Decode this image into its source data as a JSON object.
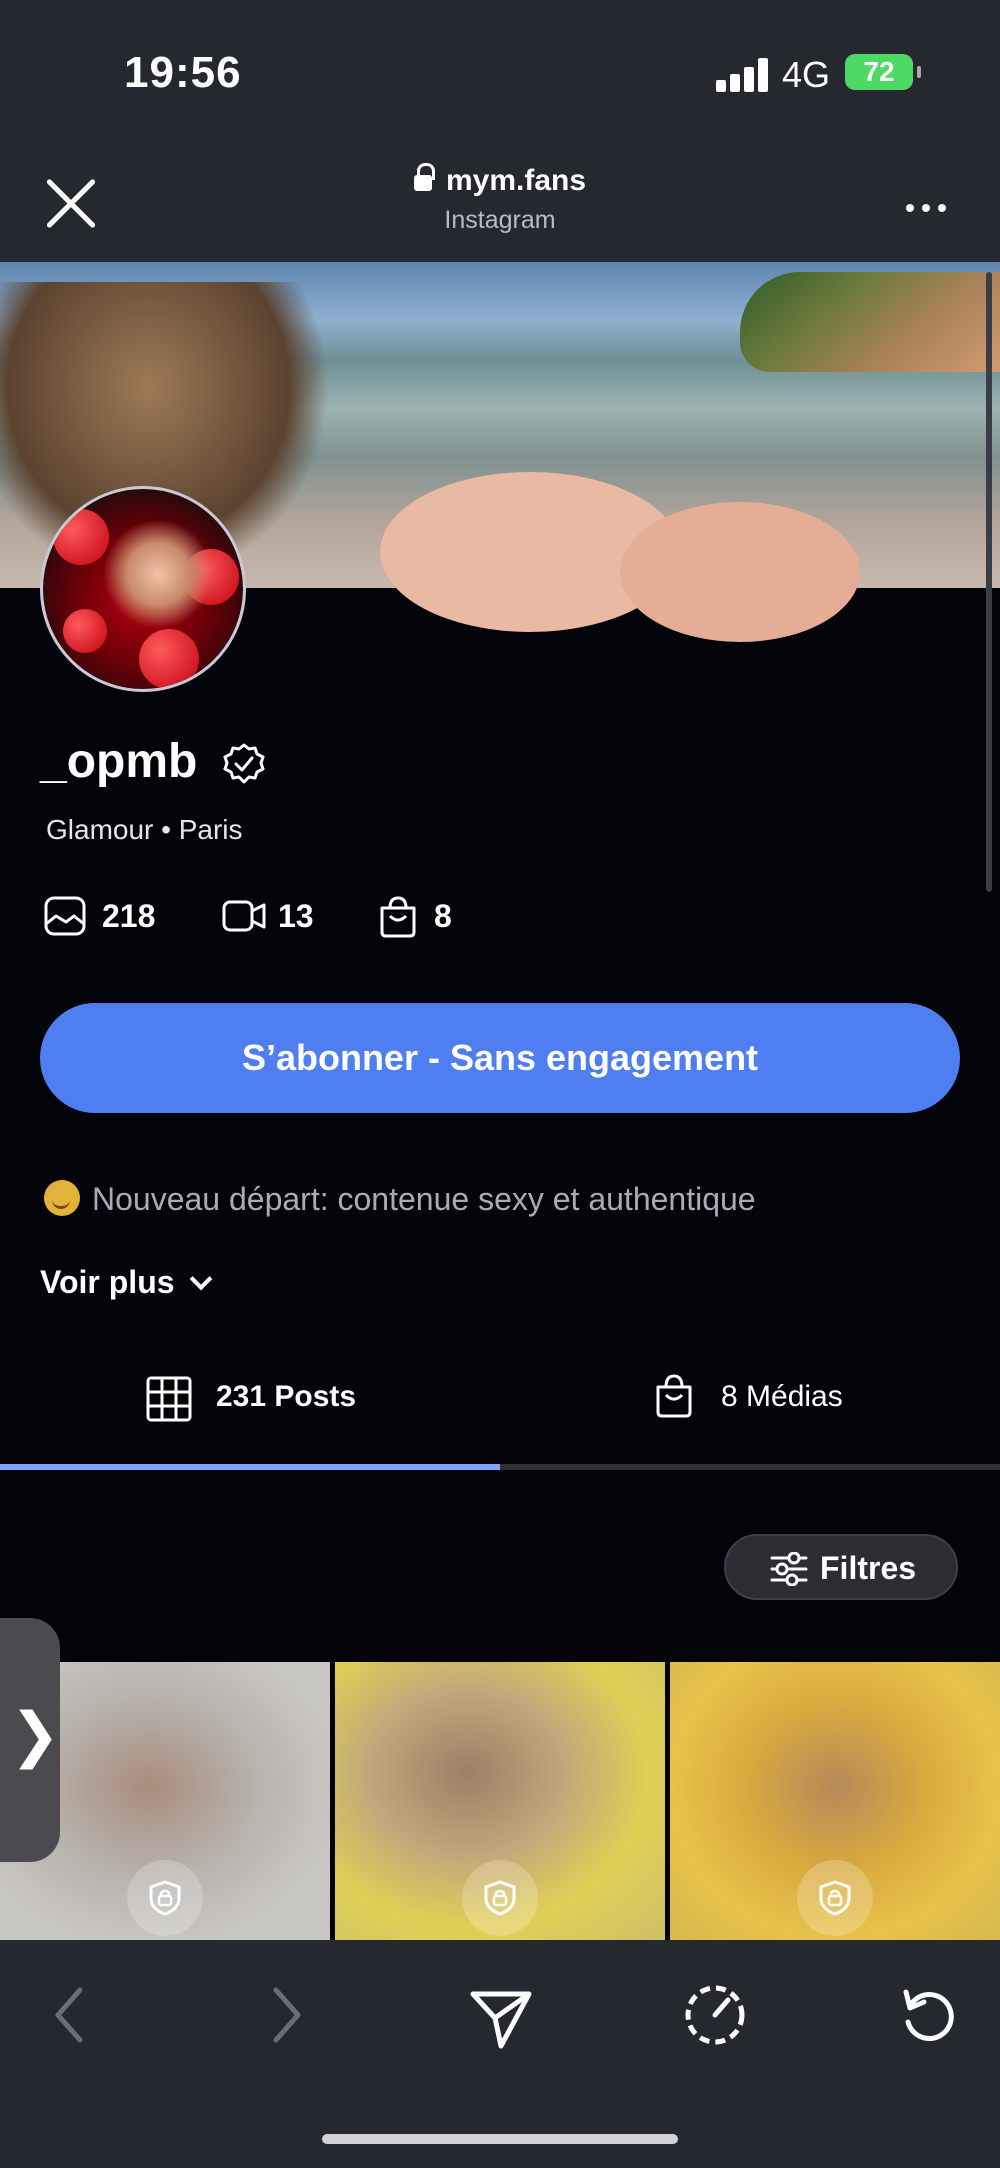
{
  "status_bar": {
    "time": "19:56",
    "network": "4G",
    "battery": "72"
  },
  "browser": {
    "domain": "mym.fans",
    "subtitle": "Instagram"
  },
  "profile": {
    "username": "_opmb",
    "meta": "Glamour • Paris",
    "stats": {
      "photos": "218",
      "videos": "13",
      "shop": "8"
    },
    "subscribe_label": "S’abonner - Sans engagement",
    "bio": "Nouveau départ: contenue sexy et authentique",
    "see_more": "Voir plus"
  },
  "tabs": [
    {
      "label": "231 Posts",
      "active": true
    },
    {
      "label": "8 Médias",
      "active": false
    }
  ],
  "filters_label": "Filtres",
  "colors": {
    "accent": "#4e7ef0",
    "background": "#03040a",
    "chrome": "#262830"
  }
}
